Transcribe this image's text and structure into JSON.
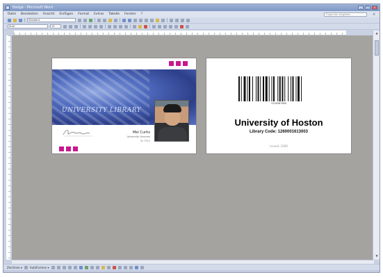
{
  "window": {
    "title": "Badge - Microsoft Word"
  },
  "menubar": {
    "items": [
      "Datei",
      "Bearbeiten",
      "Ansicht",
      "Einfügen",
      "Format",
      "Extras",
      "Tabelle",
      "Fenster",
      "?"
    ],
    "help_placeholder": "Frage hier eingeben"
  },
  "toolbar": {
    "style_combo": "Standard",
    "font_combo": "Arial",
    "size_combo": "10"
  },
  "drawbar": {
    "draw_label": "Zeichnen ▾",
    "autoshapes_label": "AutoFormen ▾"
  },
  "card_front": {
    "banner_title": "UNIVERSITY LIBRARY",
    "name": "Mel Curtis",
    "department": "University Services",
    "id_text": "ID 7512",
    "signature_text": "Curtis"
  },
  "card_back": {
    "barcode_number": "1234567890",
    "university_name": "University of Hoston",
    "library_code": "Library Code: 1260001613003",
    "issue_text": "Issued: 2008"
  },
  "colors": {
    "accent_squares": "#c8178f",
    "workspace": "#a5a3a0"
  }
}
